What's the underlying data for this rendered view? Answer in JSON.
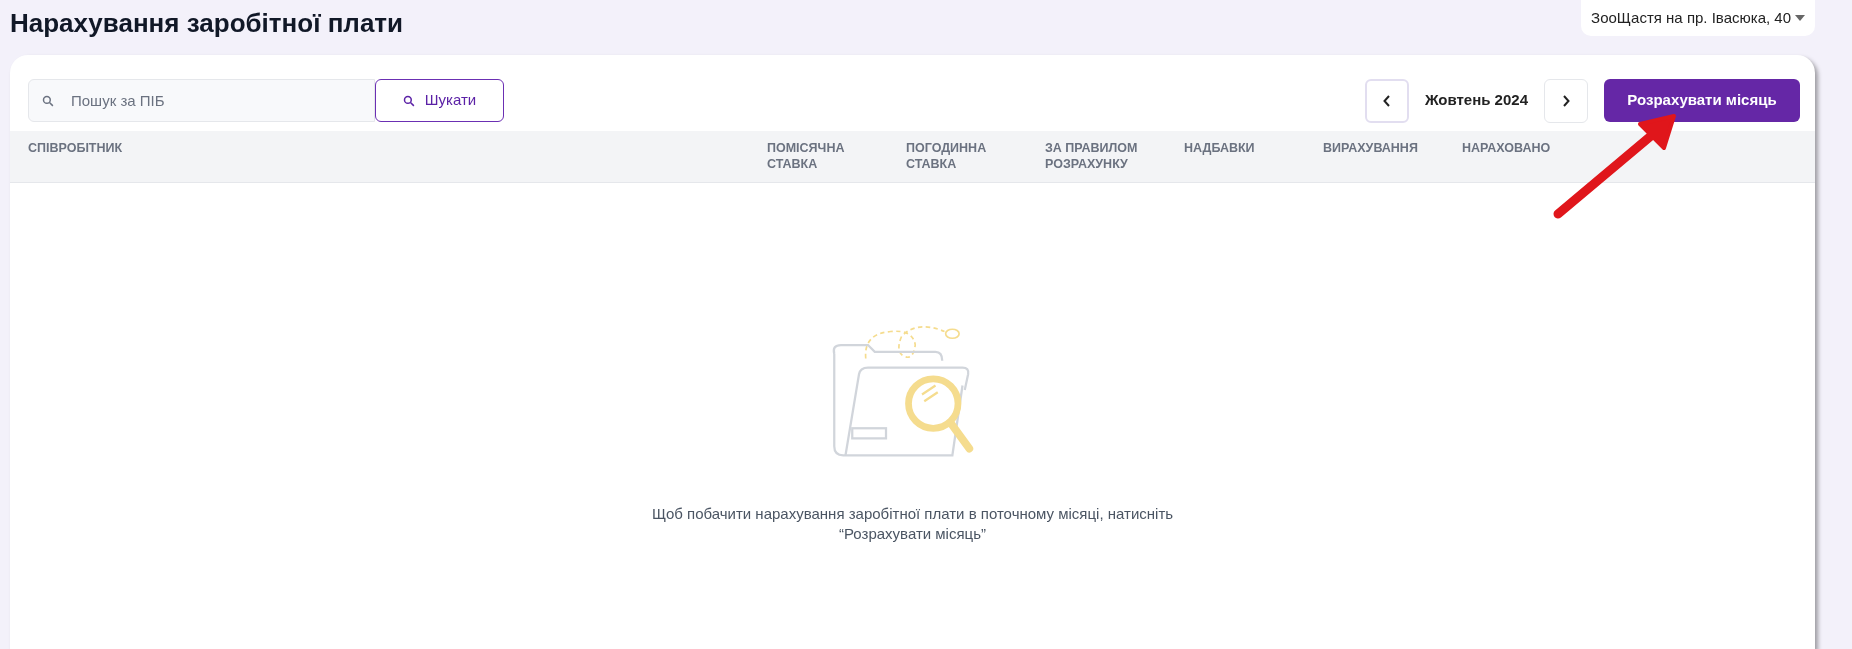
{
  "page": {
    "title": "Нарахування заробітної плати"
  },
  "location_select": {
    "value": "ЗооЩастя на пр. Івасюка, 40"
  },
  "search": {
    "placeholder": "Пошук за ПІБ",
    "button": "Шукати"
  },
  "period": {
    "label": "Жовтень 2024"
  },
  "calculate_button": "Розрахувати місяць",
  "table": {
    "columns": [
      "СПІВРОБІТНИК",
      "ПОМІСЯЧНА СТАВКА",
      "ПОГОДИННА СТАВКА",
      "ЗА ПРАВИЛОМ РОЗРАХУНКУ",
      "НАДБАВКИ",
      "ВИРАХУВАННЯ",
      "НАРАХОВАНО"
    ]
  },
  "empty_state": {
    "lines": [
      "Щоб побачити нарахування заробітної плати в поточному місяці, натисніть",
      "“Розрахувати місяць”"
    ]
  }
}
